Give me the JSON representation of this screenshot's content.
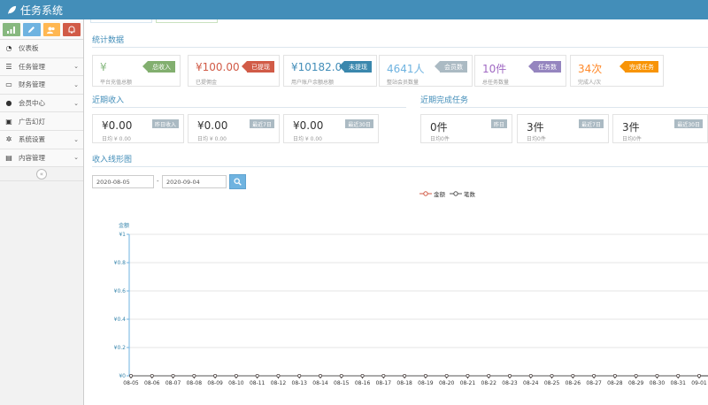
{
  "app": {
    "title": "任务系统"
  },
  "sidebar": {
    "shortcuts": [
      {
        "icon": "signal-icon",
        "color": "#87b87f"
      },
      {
        "icon": "pencil-icon",
        "color": "#6fb3e0"
      },
      {
        "icon": "users-icon",
        "color": "#ffb752"
      },
      {
        "icon": "bell-icon",
        "color": "#d15b47"
      }
    ],
    "items": [
      {
        "label": "仪表板",
        "icon": "dashboard-icon",
        "has_arrow": false
      },
      {
        "label": "任务管理",
        "icon": "list-icon",
        "has_arrow": true
      },
      {
        "label": "财务管理",
        "icon": "card-icon",
        "has_arrow": true
      },
      {
        "label": "会员中心",
        "icon": "user-icon",
        "has_arrow": true
      },
      {
        "label": "广告幻灯",
        "icon": "picture-icon",
        "has_arrow": false
      },
      {
        "label": "系统设置",
        "icon": "gear-icon",
        "has_arrow": true
      },
      {
        "label": "内容管理",
        "icon": "book-icon",
        "has_arrow": true
      }
    ],
    "collapse_icon": "double-chevron-left-icon"
  },
  "stats": {
    "title": "统计数据",
    "cards": [
      {
        "value": "¥",
        "sub": "平台充值总额",
        "badge": "总收入",
        "color": "#87b87f",
        "badge_color": "#82af6f"
      },
      {
        "value": "¥100.00",
        "sub": "已提佣金",
        "badge": "已提现",
        "color": "#d15b47",
        "badge_color": "#d15b47"
      },
      {
        "value": "¥10182.00",
        "sub": "用户账户余额总额",
        "badge": "未提现",
        "color": "#438eb9",
        "badge_color": "#3a87ad"
      },
      {
        "value": "4641人",
        "sub": "整站会员数量",
        "badge": "会员数",
        "color": "#6fb3e0",
        "badge_color": "#abbac3"
      },
      {
        "value": "10件",
        "sub": "总任务数量",
        "badge": "任务数",
        "color": "#a069c3",
        "badge_color": "#9585bf"
      },
      {
        "value": "34次",
        "sub": "完成人/次",
        "badge": "完成任务",
        "color": "#ff892a",
        "badge_color": "#f89406"
      }
    ]
  },
  "income": {
    "title": "近期收入",
    "cards": [
      {
        "value": "¥0.00",
        "sub": "日均 ¥ 0.00",
        "badge": "昨日收入"
      },
      {
        "value": "¥0.00",
        "sub": "日均 ¥ 0.00",
        "badge": "最近7日"
      },
      {
        "value": "¥0.00",
        "sub": "日均 ¥ 0.00",
        "badge": "最近30日"
      }
    ]
  },
  "tasks": {
    "title": "近期完成任务",
    "cards": [
      {
        "value": "0件",
        "sub": "日均0件",
        "badge": "昨日"
      },
      {
        "value": "3件",
        "sub": "日均0件",
        "badge": "最近7日"
      },
      {
        "value": "3件",
        "sub": "日均0件",
        "badge": "最近30日"
      }
    ]
  },
  "chart_section": {
    "title": "收入线形图",
    "date_from": "2020-08-05",
    "date_sep": "-",
    "date_to": "2020-09-04",
    "search_icon": "search-icon"
  },
  "chart_data": {
    "type": "line",
    "ylabel": "金额",
    "ylim": [
      0,
      1
    ],
    "y_ticks": [
      "¥0",
      "¥0.2",
      "¥0.4",
      "¥0.6",
      "¥0.8",
      "¥1"
    ],
    "x": [
      "08-05",
      "08-06",
      "08-07",
      "08-08",
      "08-09",
      "08-10",
      "08-11",
      "08-12",
      "08-13",
      "08-14",
      "08-15",
      "08-16",
      "08-17",
      "08-18",
      "08-19",
      "08-20",
      "08-21",
      "08-22",
      "08-23",
      "08-24",
      "08-25",
      "08-26",
      "08-27",
      "08-28",
      "08-29",
      "08-30",
      "08-31",
      "09-01"
    ],
    "series": [
      {
        "name": "金额",
        "color": "#d15b47",
        "values": [
          0,
          0,
          0,
          0,
          0,
          0,
          0,
          0,
          0,
          0,
          0,
          0,
          0,
          0,
          0,
          0,
          0,
          0,
          0,
          0,
          0,
          0,
          0,
          0,
          0,
          0,
          0,
          0
        ]
      },
      {
        "name": "笔数",
        "color": "#555555",
        "values": [
          0,
          0,
          0,
          0,
          0,
          0,
          0,
          0,
          0,
          0,
          0,
          0,
          0,
          0,
          0,
          0,
          0,
          0,
          0,
          0,
          0,
          0,
          0,
          0,
          0,
          0,
          0,
          0
        ]
      }
    ],
    "grid": true,
    "legend_position": "top-center"
  }
}
